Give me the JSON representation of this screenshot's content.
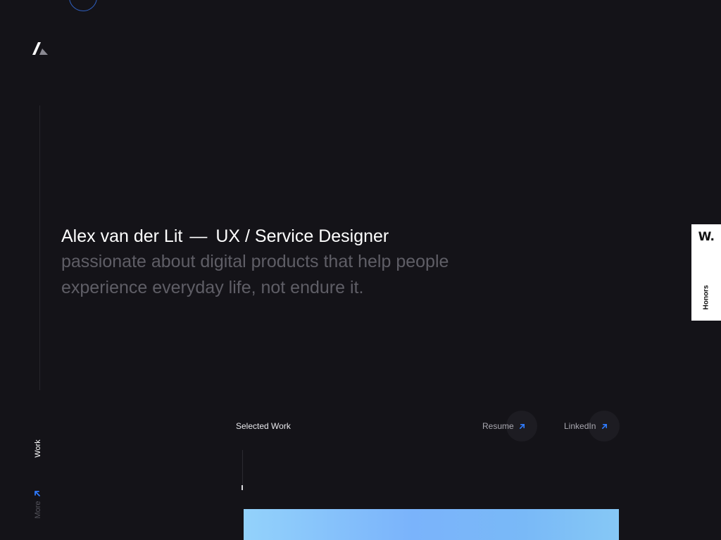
{
  "hero": {
    "name": "Alex van der Lit",
    "dash": "—",
    "role": "UX / Service Designer",
    "tagline": "passionate about digital products that help people experience everyday life, not endure it."
  },
  "honors_tab": {
    "badge": "W.",
    "label": "Honors"
  },
  "side_nav": {
    "work_label": "Work",
    "more_label": "More"
  },
  "section": {
    "title": "Selected Work",
    "links": [
      {
        "label": "Resume",
        "icon": "arrow-up-right-icon"
      },
      {
        "label": "LinkedIn",
        "icon": "arrow-up-right-icon"
      }
    ]
  },
  "colors": {
    "background": "#141318",
    "accent": "#2f7bff",
    "muted_text": "#5f5e66"
  },
  "icons": [
    "logo-icon",
    "arrow-up-right-icon",
    "arrow-up-left-icon"
  ]
}
